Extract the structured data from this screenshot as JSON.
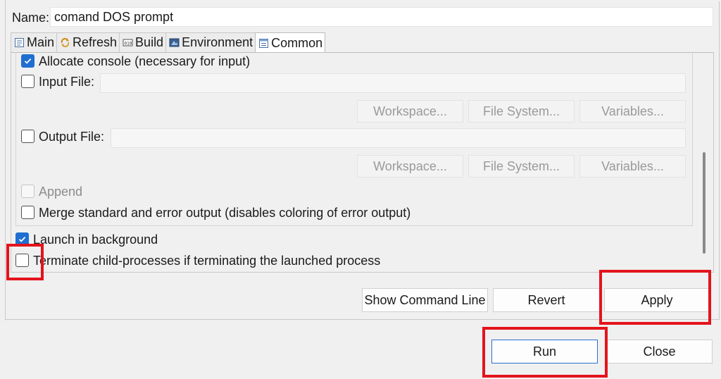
{
  "name_field": {
    "label": "Name:",
    "value": "comand DOS prompt"
  },
  "tabs": [
    {
      "label": "Main",
      "icon": "main-tab-icon",
      "active": false
    },
    {
      "label": "Refresh",
      "icon": "refresh-icon",
      "active": false
    },
    {
      "label": "Build",
      "icon": "build-icon",
      "active": false
    },
    {
      "label": "Environment",
      "icon": "environment-icon",
      "active": false
    },
    {
      "label": "Common",
      "icon": "common-tab-icon",
      "active": true
    }
  ],
  "options": {
    "allocate_console": {
      "label": "Allocate console (necessary for input)",
      "checked": true
    },
    "input_file": {
      "label": "Input File:",
      "checked": false,
      "value": ""
    },
    "output_file": {
      "label": "Output File:",
      "checked": false,
      "value": ""
    },
    "append": {
      "label": "Append",
      "checked": false,
      "enabled": false
    },
    "merge_output": {
      "label": "Merge standard and error output (disables coloring of error output)",
      "checked": false
    },
    "launch_background": {
      "label": "Launch in background",
      "checked": true
    },
    "terminate_children": {
      "label": "Terminate child-processes if terminating the launched process",
      "checked": false
    }
  },
  "file_buttons": {
    "workspace": "Workspace...",
    "file_system": "File System...",
    "variables": "Variables..."
  },
  "actions": {
    "show_command_line": "Show Command Line",
    "revert": "Revert",
    "apply": "Apply"
  },
  "dialog": {
    "run": "Run",
    "close": "Close"
  },
  "colors": {
    "highlight_box": "#e3141c",
    "checkbox_checked": "#1f6fd1",
    "primary_border": "#2a6fcf"
  }
}
